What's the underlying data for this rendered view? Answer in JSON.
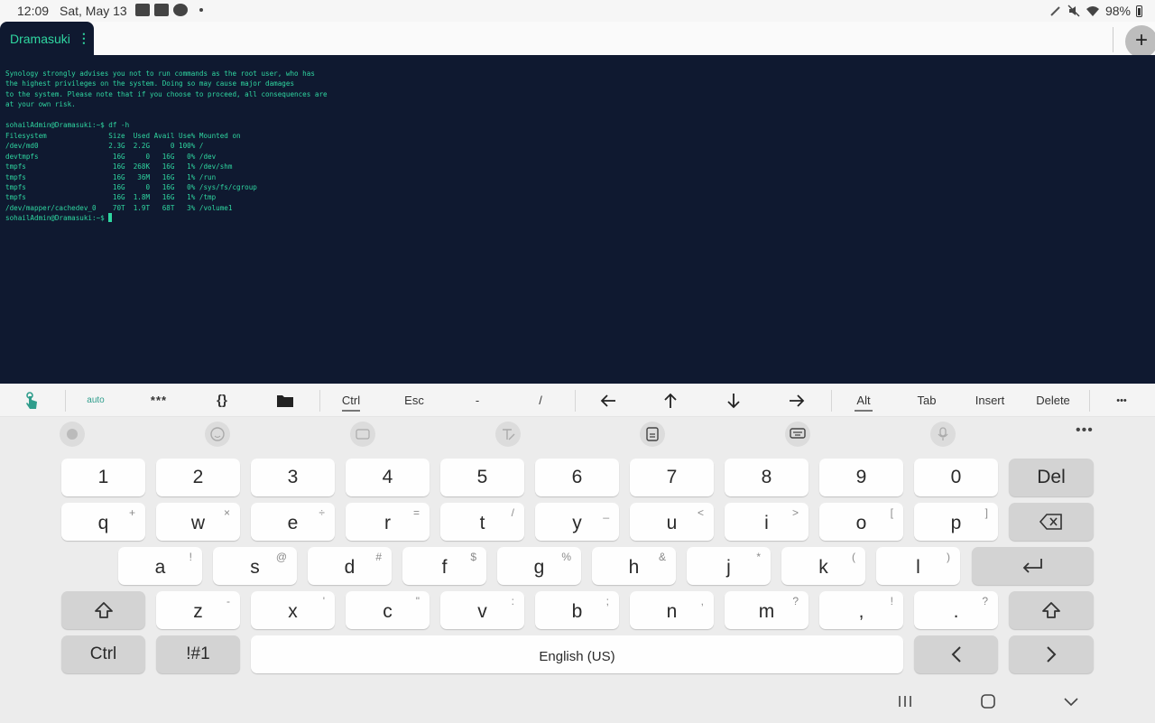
{
  "status_bar": {
    "time": "12:09",
    "date": "Sat, May 13",
    "battery": "98%"
  },
  "tab": {
    "title": "Dramasuki",
    "menu": "⋮"
  },
  "new_tab_label": "+",
  "terminal": {
    "warning": [
      "Synology strongly advises you not to run commands as the root user, who has",
      "the highest privileges on the system. Doing so may cause major damages",
      "to the system. Please note that if you choose to proceed, all consequences are",
      "at your own risk."
    ],
    "command_line": "sohailAdmin@Dramasuki:~$ df -h",
    "df_header": "Filesystem               Size  Used Avail Use% Mounted on",
    "df_rows": [
      "/dev/md0                 2.3G  2.2G     0 100% /",
      "devtmpfs                  16G     0   16G   0% /dev",
      "tmpfs                     16G  268K   16G   1% /dev/shm",
      "tmpfs                     16G   36M   16G   1% /run",
      "tmpfs                     16G     0   16G   0% /sys/fs/cgroup",
      "tmpfs                     16G  1.8M   16G   1% /tmp",
      "/dev/mapper/cachedev_0    70T  1.9T   68T   3% /volume1"
    ],
    "prompt": "sohailAdmin@Dramasuki:~$ "
  },
  "extra_keys": {
    "auto": "auto",
    "stars": "***",
    "braces": "{}",
    "ctrl": "Ctrl",
    "esc": "Esc",
    "dash": "-",
    "slash": "/",
    "alt": "Alt",
    "tab": "Tab",
    "insert": "Insert",
    "delete": "Delete",
    "more": "•••"
  },
  "keyboard": {
    "more": "•••",
    "row1": [
      "1",
      "2",
      "3",
      "4",
      "5",
      "6",
      "7",
      "8",
      "9",
      "0"
    ],
    "del": "Del",
    "row2": [
      {
        "k": "q",
        "s": "+"
      },
      {
        "k": "w",
        "s": "×"
      },
      {
        "k": "e",
        "s": "÷"
      },
      {
        "k": "r",
        "s": "="
      },
      {
        "k": "t",
        "s": "/"
      },
      {
        "k": "y",
        "s": "_"
      },
      {
        "k": "u",
        "s": "<"
      },
      {
        "k": "i",
        "s": ">"
      },
      {
        "k": "o",
        "s": "["
      },
      {
        "k": "p",
        "s": "]"
      }
    ],
    "row3": [
      {
        "k": "a",
        "s": "!"
      },
      {
        "k": "s",
        "s": "@"
      },
      {
        "k": "d",
        "s": "#"
      },
      {
        "k": "f",
        "s": "$"
      },
      {
        "k": "g",
        "s": "%"
      },
      {
        "k": "h",
        "s": "&"
      },
      {
        "k": "j",
        "s": "*"
      },
      {
        "k": "k",
        "s": "("
      },
      {
        "k": "l",
        "s": ")"
      }
    ],
    "row4": [
      {
        "k": "z",
        "s": "-"
      },
      {
        "k": "x",
        "s": "'"
      },
      {
        "k": "c",
        "s": "\""
      },
      {
        "k": "v",
        "s": ":"
      },
      {
        "k": "b",
        "s": ";"
      },
      {
        "k": "n",
        "s": ","
      },
      {
        "k": "m",
        "s": "?"
      },
      {
        "k": ",",
        "s": "!"
      },
      {
        "k": ".",
        "s": "?"
      }
    ],
    "ctrl": "Ctrl",
    "symbols": "!#1",
    "space": "English (US)",
    "left": "<",
    "right": ">"
  }
}
